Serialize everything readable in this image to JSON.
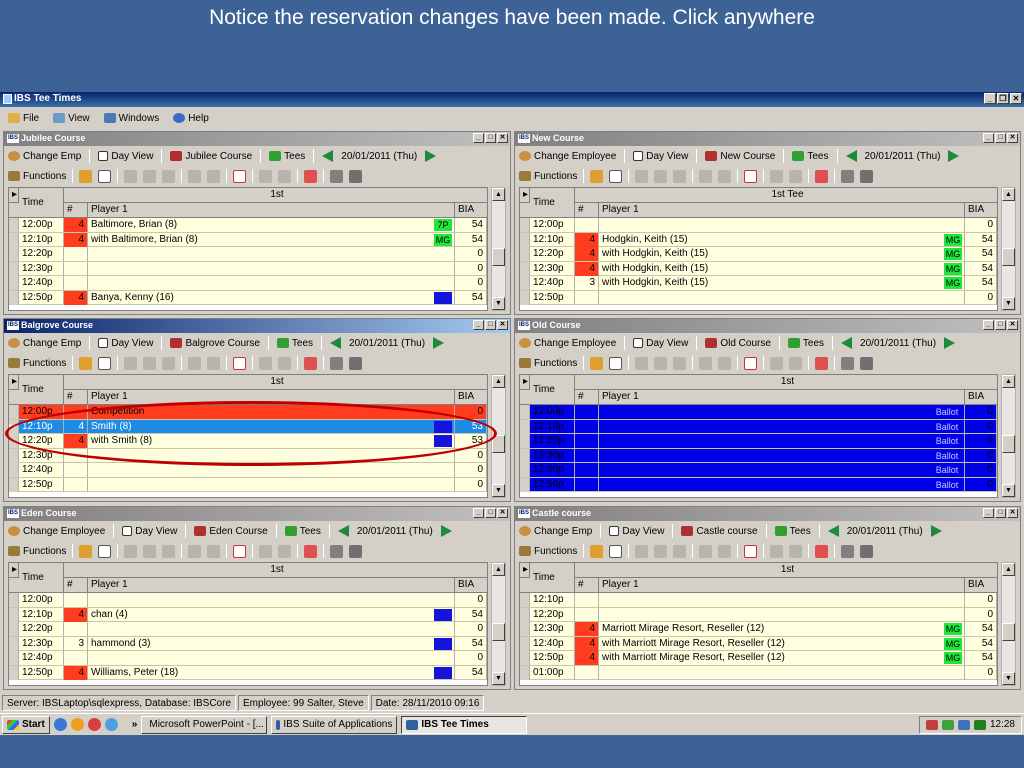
{
  "caption": "Notice the reservation changes have been made. Click anywhere",
  "app": {
    "title": "IBS Tee Times",
    "menu": [
      "File",
      "View",
      "Windows",
      "Help"
    ],
    "functions_label": "Functions"
  },
  "panes": [
    {
      "id": "jubilee",
      "title": "Jubilee Course",
      "change_label": "Change Emp",
      "day_view": "Day View",
      "course_label": "Jubilee Course",
      "tees": "Tees",
      "date": "20/01/2011 (Thu)",
      "tee": "1st",
      "headers": {
        "time": "Time",
        "num": "#",
        "player": "Player 1",
        "bia": "BIA"
      },
      "rows": [
        {
          "time": "12:00p",
          "num": "4",
          "player": "Baltimore, Brian (8)",
          "badge": "7P",
          "badge_color": "green",
          "bia": "54",
          "num_color": "red"
        },
        {
          "time": "12:10p",
          "num": "4",
          "player": "with Baltimore, Brian (8)",
          "badge": "MG",
          "badge_color": "green",
          "bia": "54",
          "num_color": "red"
        },
        {
          "time": "12:20p",
          "num": "",
          "player": "",
          "badge": "",
          "bia": "0"
        },
        {
          "time": "12:30p",
          "num": "",
          "player": "",
          "badge": "",
          "bia": "0"
        },
        {
          "time": "12:40p",
          "num": "",
          "player": "",
          "badge": "",
          "bia": "0"
        },
        {
          "time": "12:50p",
          "num": "4",
          "player": "Banya, Kenny (16)",
          "badge": " ",
          "badge_color": "blue",
          "bia": "54",
          "num_color": "red"
        }
      ]
    },
    {
      "id": "new",
      "title": "New Course",
      "change_label": "Change Employee",
      "day_view": "Day View",
      "course_label": "New Course",
      "tees": "Tees",
      "date": "20/01/2011 (Thu)",
      "tee": "1st Tee",
      "headers": {
        "time": "Time",
        "num": "#",
        "player": "Player 1",
        "bia": "BIA"
      },
      "rows": [
        {
          "time": "12:00p",
          "num": "",
          "player": "",
          "badge": "",
          "bia": "0"
        },
        {
          "time": "12:10p",
          "num": "4",
          "player": "Hodgkin, Keith (15)",
          "badge": "MG",
          "badge_color": "green",
          "bia": "54",
          "num_color": "red"
        },
        {
          "time": "12:20p",
          "num": "4",
          "player": "with Hodgkin, Keith (15)",
          "badge": "MG",
          "badge_color": "green",
          "bia": "54",
          "num_color": "red"
        },
        {
          "time": "12:30p",
          "num": "4",
          "player": "with Hodgkin, Keith (15)",
          "badge": "MG",
          "badge_color": "green",
          "bia": "54",
          "num_color": "red"
        },
        {
          "time": "12:40p",
          "num": "3",
          "player": "with Hodgkin, Keith (15)",
          "badge": "MG",
          "badge_color": "green",
          "bia": "54"
        },
        {
          "time": "12:50p",
          "num": "",
          "player": "",
          "badge": "",
          "bia": "0"
        }
      ]
    },
    {
      "id": "balgrove",
      "title": "Balgrove Course",
      "change_label": "Change Emp",
      "day_view": "Day View",
      "course_label": "Balgrove Course",
      "tees": "Tees",
      "date": "20/01/2011 (Thu)",
      "tee": "1st",
      "headers": {
        "time": "Time",
        "num": "#",
        "player": "Player 1",
        "bia": "BIA"
      },
      "rows": [
        {
          "time": "12:00p",
          "num": "",
          "player": "Competition",
          "badge": "",
          "bia": "0",
          "row_color": "red"
        },
        {
          "time": "12:10p",
          "num": "4",
          "player": "Smith (8)",
          "badge": " ",
          "badge_color": "blue",
          "bia": "53",
          "row_color": "selected"
        },
        {
          "time": "12:20p",
          "num": "4",
          "player": "with Smith (8)",
          "badge": " ",
          "badge_color": "blue",
          "bia": "53",
          "num_color": "red"
        },
        {
          "time": "12:30p",
          "num": "",
          "player": "",
          "badge": "",
          "bia": "0"
        },
        {
          "time": "12:40p",
          "num": "",
          "player": "",
          "badge": "",
          "bia": "0"
        },
        {
          "time": "12:50p",
          "num": "",
          "player": "",
          "badge": "",
          "bia": "0"
        }
      ]
    },
    {
      "id": "old",
      "title": "Old Course",
      "change_label": "Change Employee",
      "day_view": "Day View",
      "course_label": "Old Course",
      "tees": "Tees",
      "date": "20/01/2011 (Thu)",
      "tee": "1st",
      "headers": {
        "time": "Time",
        "num": "#",
        "player": "Player 1",
        "bia": "BIA"
      },
      "rows": [
        {
          "time": "12:00p",
          "num": "",
          "player": "",
          "badge": "Ballot",
          "bia": "0",
          "row_color": "blue"
        },
        {
          "time": "12:10p",
          "num": "",
          "player": "",
          "badge": "Ballot",
          "bia": "0",
          "row_color": "blue"
        },
        {
          "time": "12:20p",
          "num": "",
          "player": "",
          "badge": "Ballot",
          "bia": "0",
          "row_color": "blue"
        },
        {
          "time": "12:30p",
          "num": "",
          "player": "",
          "badge": "Ballot",
          "bia": "0",
          "row_color": "blue"
        },
        {
          "time": "12:40p",
          "num": "",
          "player": "",
          "badge": "Ballot",
          "bia": "0",
          "row_color": "blue"
        },
        {
          "time": "12:50p",
          "num": "",
          "player": "",
          "badge": "Ballot",
          "bia": "0",
          "row_color": "blue"
        }
      ]
    },
    {
      "id": "eden",
      "title": "Eden Course",
      "change_label": "Change Employee",
      "day_view": "Day View",
      "course_label": "Eden Course",
      "tees": "Tees",
      "date": "20/01/2011 (Thu)",
      "tee": "1st",
      "headers": {
        "time": "Time",
        "num": "#",
        "player": "Player 1",
        "bia": "BIA"
      },
      "rows": [
        {
          "time": "12:00p",
          "num": "",
          "player": "",
          "badge": "",
          "bia": "0"
        },
        {
          "time": "12:10p",
          "num": "4",
          "player": "chan (4)",
          "badge": " ",
          "badge_color": "blue",
          "bia": "54",
          "num_color": "red"
        },
        {
          "time": "12:20p",
          "num": "",
          "player": "",
          "badge": "",
          "bia": "0"
        },
        {
          "time": "12:30p",
          "num": "3",
          "player": "hammond (3)",
          "badge": " ",
          "badge_color": "blue",
          "bia": "54"
        },
        {
          "time": "12:40p",
          "num": "",
          "player": "",
          "badge": "",
          "bia": "0"
        },
        {
          "time": "12:50p",
          "num": "4",
          "player": "Williams, Peter (18)",
          "badge": " ",
          "badge_color": "blue",
          "bia": "54",
          "num_color": "red"
        }
      ]
    },
    {
      "id": "castle",
      "title": "Castle course",
      "change_label": "Change Emp",
      "day_view": "Day View",
      "course_label": "Castle course",
      "tees": "Tees",
      "date": "20/01/2011 (Thu)",
      "tee": "1st",
      "headers": {
        "time": "Time",
        "num": "#",
        "player": "Player 1",
        "bia": "BIA"
      },
      "rows": [
        {
          "time": "12:10p",
          "num": "",
          "player": "",
          "badge": "",
          "bia": "0"
        },
        {
          "time": "12:20p",
          "num": "",
          "player": "",
          "badge": "",
          "bia": "0"
        },
        {
          "time": "12:30p",
          "num": "4",
          "player": "Marriott Mirage Resort, Reseller (12)",
          "badge": "MG",
          "badge_color": "green",
          "bia": "54",
          "num_color": "red"
        },
        {
          "time": "12:40p",
          "num": "4",
          "player": "with Marriott Mirage Resort, Reseller (12)",
          "badge": "MG",
          "badge_color": "green",
          "bia": "54",
          "num_color": "red"
        },
        {
          "time": "12:50p",
          "num": "4",
          "player": "with Marriott Mirage Resort, Reseller (12)",
          "badge": "MG",
          "badge_color": "green",
          "bia": "54",
          "num_color": "red"
        },
        {
          "time": "01:00p",
          "num": "",
          "player": "",
          "badge": "",
          "bia": "0"
        }
      ]
    }
  ],
  "status": {
    "server": "Server: IBSLaptop\\sqlexpress, Database: IBSCore",
    "employee": "Employee: 99 Salter, Steve",
    "date": "Date: 28/11/2010 09:16"
  },
  "taskbar": {
    "start": "Start",
    "tasks": [
      "Microsoft PowerPoint - [...",
      "IBS Suite of Applications",
      "IBS Tee Times"
    ],
    "clock": "12:28",
    "chevron": "»"
  }
}
